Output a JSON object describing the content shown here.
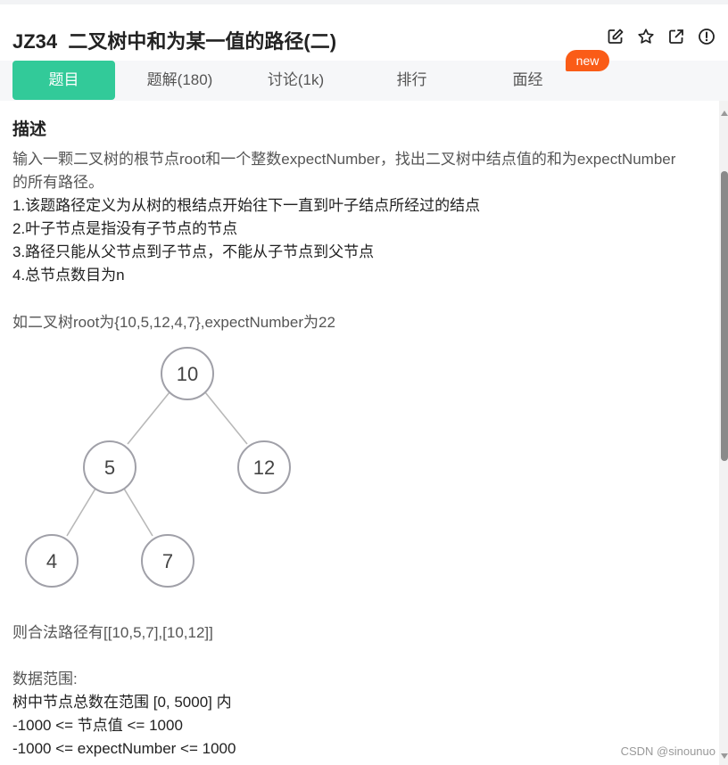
{
  "header": {
    "title": "JZ34  二叉树中和为某一值的路径(二)",
    "icons": [
      "edit-icon",
      "star-icon",
      "external-link-icon",
      "info-icon"
    ]
  },
  "tabs": [
    {
      "label": "题目",
      "active": true
    },
    {
      "label": "题解(180)",
      "active": false
    },
    {
      "label": "讨论(1k)",
      "active": false
    },
    {
      "label": "排行",
      "active": false
    },
    {
      "label": "面经",
      "active": false
    }
  ],
  "badge": "new",
  "description": {
    "heading": "描述",
    "intro_line1": "输入一颗二叉树的根节点root和一个整数expectNumber，找出二叉树中结点值的和为expectNumber",
    "intro_line2": "的所有路径。",
    "rules": [
      "1.该题路径定义为从树的根结点开始往下一直到叶子结点所经过的结点",
      "2.叶子节点是指没有子节点的节点",
      "3.路径只能从父节点到子节点，不能从子节点到父节点",
      "4.总节点数目为n"
    ],
    "example": "如二叉树root为{10,5,12,4,7},expectNumber为22",
    "tree_nodes": [
      "10",
      "5",
      "12",
      "4",
      "7"
    ],
    "result": "则合法路径有[[10,5,7],[10,12]]",
    "range_heading": "数据范围:",
    "range_lines": [
      "树中节点总数在范围 [0, 5000] 内",
      "-1000 <= 节点值 <= 1000",
      "-1000 <= expectNumber <= 1000"
    ]
  },
  "watermark": "CSDN @sinounuo",
  "colors": {
    "accent": "#32ca99",
    "badge": "#fa5c17",
    "node_stroke": "#a0a0a8"
  }
}
